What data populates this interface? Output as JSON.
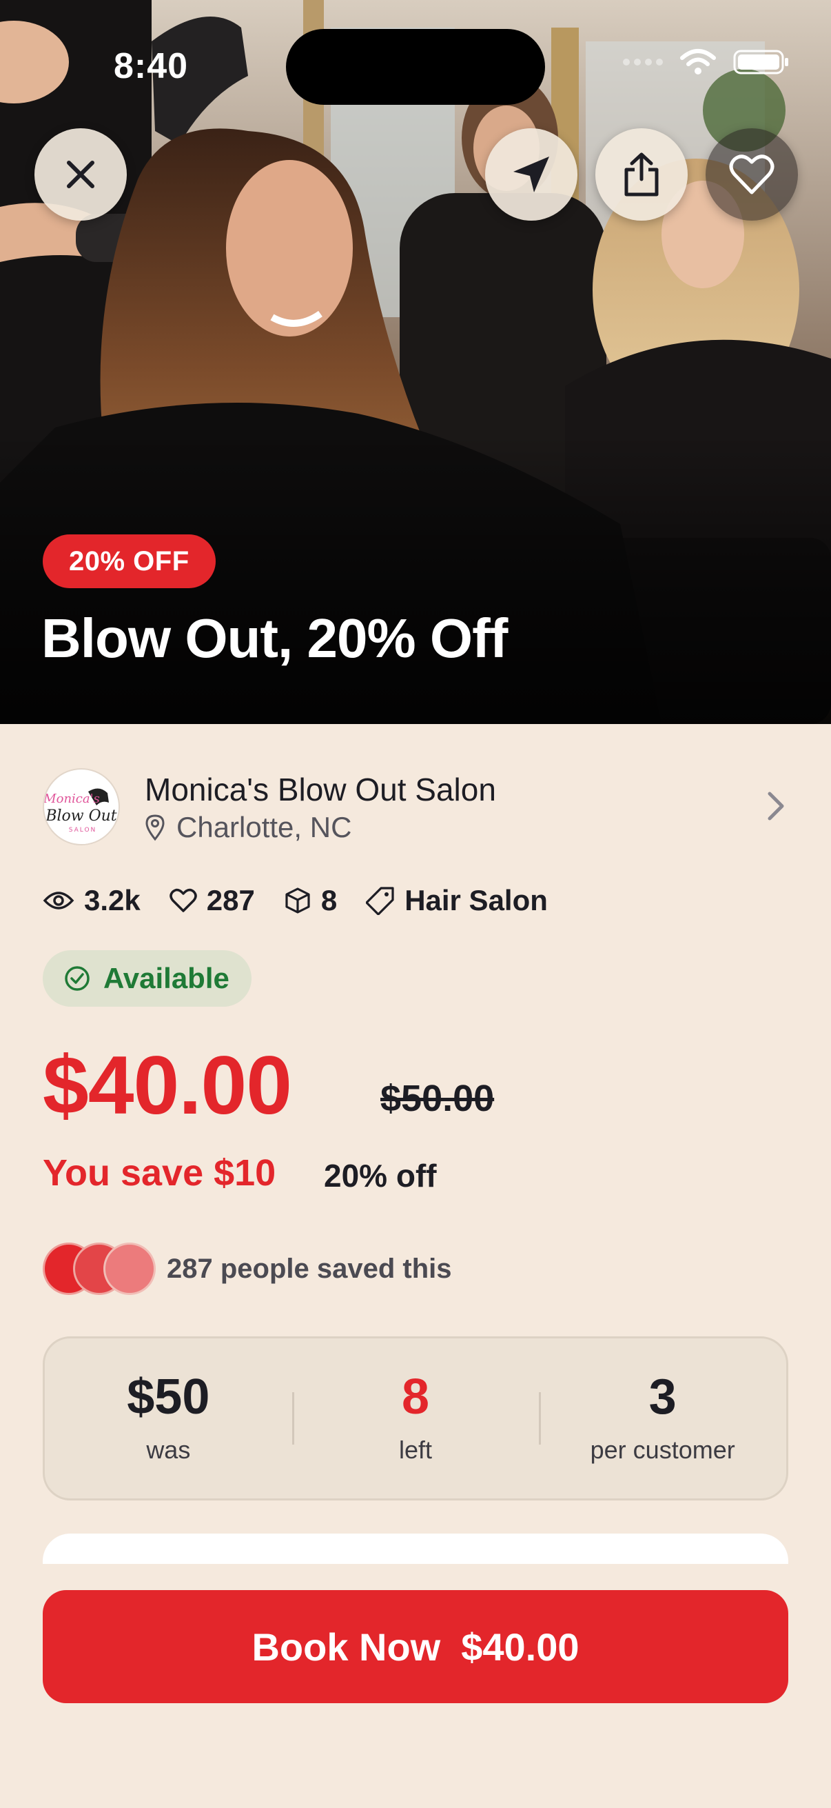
{
  "status_bar": {
    "time": "8:40"
  },
  "hero": {
    "discount_badge": "20% OFF",
    "title": "Blow Out, 20% Off"
  },
  "top_actions": {
    "close_icon": "close-icon",
    "directions_icon": "navigation-arrow-icon",
    "share_icon": "share-icon",
    "favorite_icon": "heart-icon"
  },
  "vendor": {
    "name": "Monica's Blow Out Salon",
    "location": "Charlotte, NC",
    "logo_text": "Monica's Blow Out Salon"
  },
  "stats": {
    "views": "3.2k",
    "likes": "287",
    "stock": "8",
    "category": "Hair Salon"
  },
  "availability": "Available",
  "pricing": {
    "price": "$40.00",
    "original_price": "$50.00",
    "you_save": "You save $10",
    "percent_off": "20% off"
  },
  "social_proof": "287 people saved this",
  "info_card": [
    {
      "value": "$50",
      "label": "was"
    },
    {
      "value": "8",
      "label": "left"
    },
    {
      "value": "3",
      "label": "per customer"
    }
  ],
  "cta": {
    "label": "Book Now",
    "price": "$40.00"
  },
  "colors": {
    "accent": "#e3262b",
    "background": "#f5e9dd",
    "available_green": "#1f7a36"
  }
}
